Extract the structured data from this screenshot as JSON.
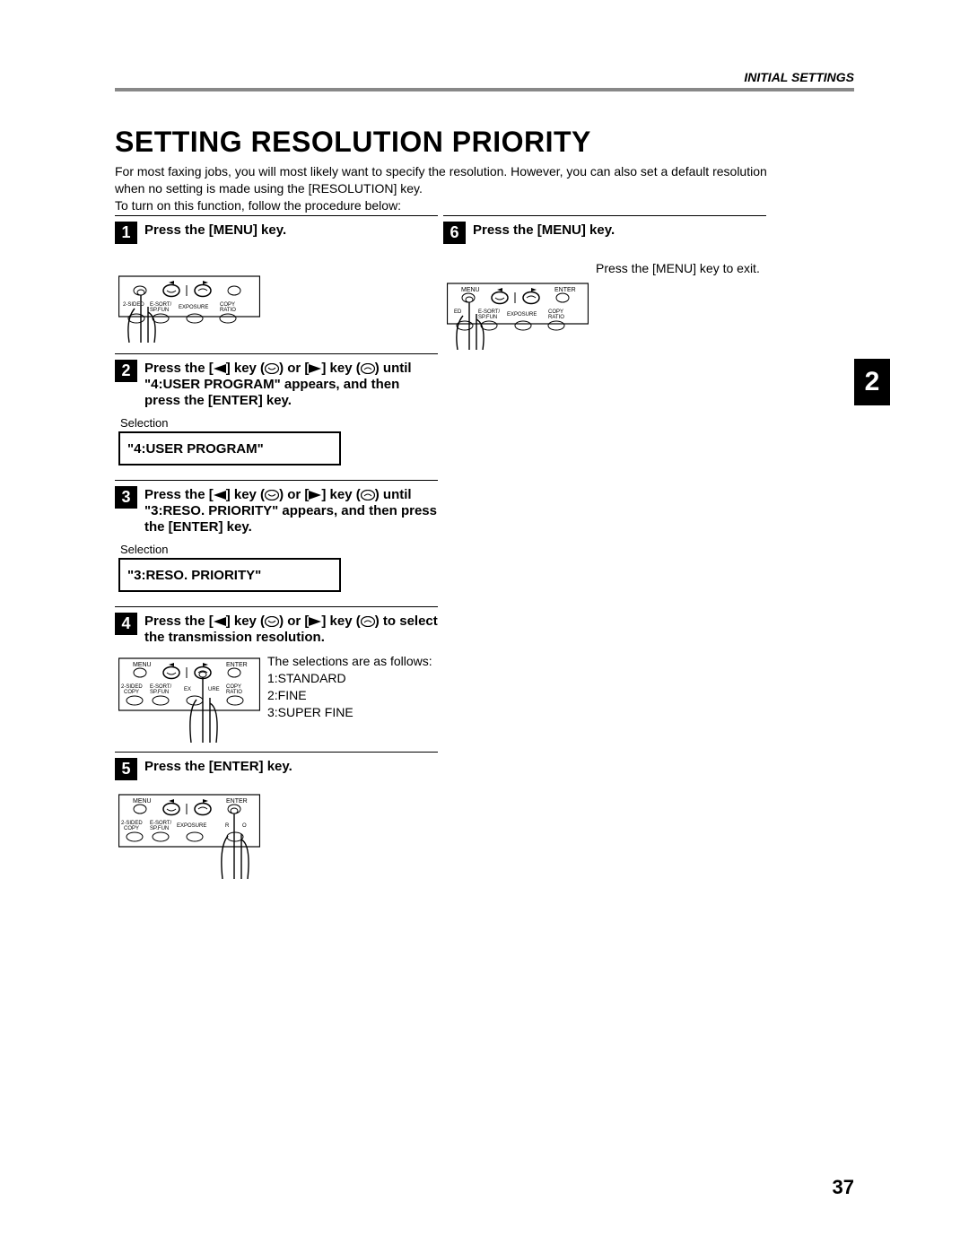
{
  "header_label": "INITIAL SETTINGS",
  "title": "SETTING RESOLUTION PRIORITY",
  "intro": "For most faxing jobs, you will most likely want to specify the resolution. However, you can also set a default resolution when no setting is made using the [RESOLUTION] key.\nTo turn on this function, follow the procedure below:",
  "side_tab": "2",
  "page_number": "37",
  "panel_labels": {
    "menu": "MENU",
    "enter": "ENTER",
    "two_sided": "2-SIDED",
    "copy": "COPY",
    "esort": "E-SORT/",
    "spfun": "SP.FUN",
    "exposure": "EXPOSURE",
    "ratio": "RATIO",
    "copy_ratio": "COPY"
  },
  "steps": {
    "s1": {
      "num": "1",
      "title": "Press the [MENU] key."
    },
    "s2": {
      "num": "2",
      "title_pre": "Press the [",
      "title_mid1": "] key (",
      "title_mid2": ") or [",
      "title_mid3": "] key (",
      "title_post": ") until \"4:USER PROGRAM\" appears, and then press the [ENTER] key.",
      "selection_label": "Selection",
      "display": "\"4:USER PROGRAM\""
    },
    "s3": {
      "num": "3",
      "title_pre": "Press the [",
      "title_mid1": "] key (",
      "title_mid2": ") or [",
      "title_mid3": "] key (",
      "title_post": ") until \"3:RESO. PRIORITY\" appears, and then press the [ENTER] key.",
      "selection_label": "Selection",
      "display": "\"3:RESO. PRIORITY\""
    },
    "s4": {
      "num": "4",
      "title_pre": "Press the [",
      "title_mid1": "] key (",
      "title_mid2": ") or [",
      "title_mid3": "] key (",
      "title_post": ") to select the transmission resolution.",
      "side_text": "The selections are as follows:\n1:STANDARD\n2:FINE\n3:SUPER FINE"
    },
    "s5": {
      "num": "5",
      "title": "Press the [ENTER] key."
    },
    "s6": {
      "num": "6",
      "title": "Press the [MENU] key.",
      "side_text": "Press the [MENU] key to exit."
    }
  }
}
